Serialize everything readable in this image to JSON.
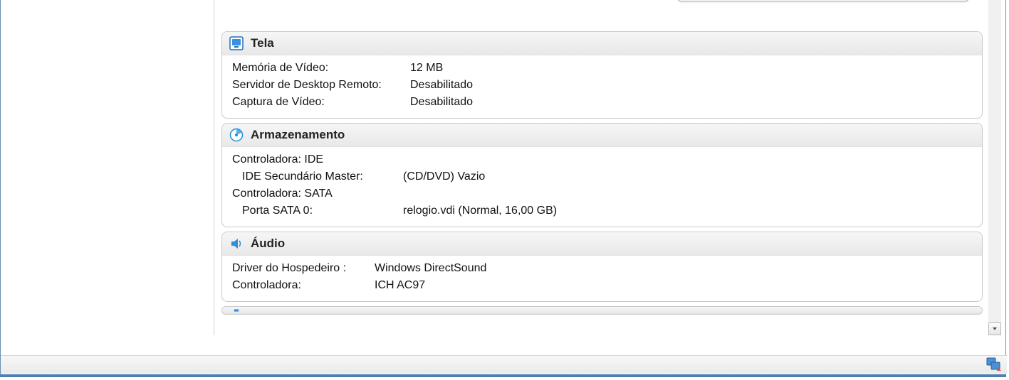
{
  "sections": {
    "display": {
      "title": "Tela",
      "rows": [
        {
          "label": "Memória de Vídeo:",
          "value": "12 MB"
        },
        {
          "label": "Servidor de Desktop Remoto:",
          "value": "Desabilitado"
        },
        {
          "label": "Captura de Vídeo:",
          "value": "Desabilitado"
        }
      ]
    },
    "storage": {
      "title": "Armazenamento",
      "controller_ide_label": "Controladora: IDE",
      "ide_port_label": "IDE Secundário Master:",
      "ide_port_value": "(CD/DVD) Vazio",
      "controller_sata_label": "Controladora: SATA",
      "sata_port_label": "Porta SATA 0:",
      "sata_port_value": "relogio.vdi (Normal, 16,00 GB)"
    },
    "audio": {
      "title": "Áudio",
      "rows": [
        {
          "label": "Driver do Hospedeiro :",
          "value": "Windows DirectSound"
        },
        {
          "label": "Controladora:",
          "value": "ICH AC97"
        }
      ]
    }
  }
}
